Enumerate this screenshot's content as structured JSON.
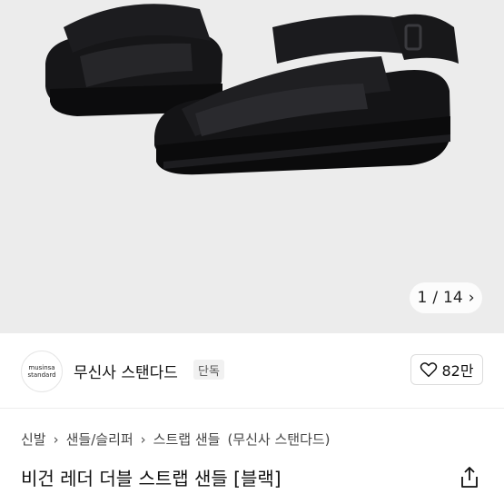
{
  "image_viewer": {
    "current": "1",
    "separator": "/",
    "total": "14"
  },
  "brand": {
    "logo_line1": "musinsa",
    "logo_line2": "standard",
    "name": "무신사 스탠다드",
    "badge": "단독"
  },
  "like": {
    "count": "82만"
  },
  "breadcrumb": [
    "신발",
    "샌들/슬리퍼",
    "스트랩 샌들",
    "(무신사 스탠다드)"
  ],
  "product": {
    "title": "비건 레더 더블 스트랩 샌들 [블랙]"
  },
  "colors": {
    "image_bg": "#ececec",
    "sandal": "#141416"
  }
}
